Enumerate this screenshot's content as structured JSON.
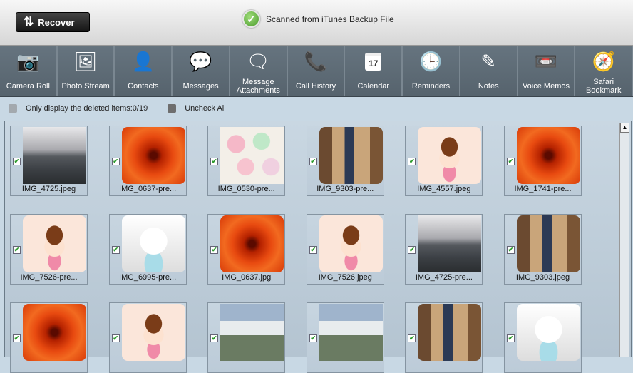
{
  "header": {
    "recover_label": "Recover",
    "status_text": "Scanned from iTunes Backup File"
  },
  "toolbar": [
    {
      "label": "Camera Roll",
      "icon": "camera-icon",
      "glyph": "📷"
    },
    {
      "label": "Photo Stream",
      "icon": "photo-stream-icon",
      "glyph": "🖼"
    },
    {
      "label": "Contacts",
      "icon": "contact-icon",
      "glyph": "👤"
    },
    {
      "label": "Messages",
      "icon": "message-bubble-icon",
      "glyph": "💬"
    },
    {
      "label": "Message Attachments",
      "icon": "message-attachment-icon",
      "glyph": "🗨"
    },
    {
      "label": "Call History",
      "icon": "phone-icon",
      "glyph": "📞"
    },
    {
      "label": "Calendar",
      "icon": "calendar-icon",
      "glyph": "17"
    },
    {
      "label": "Reminders",
      "icon": "clock-icon",
      "glyph": "🕒"
    },
    {
      "label": "Notes",
      "icon": "note-pen-icon",
      "glyph": "✎"
    },
    {
      "label": "Voice Memos",
      "icon": "cassette-icon",
      "glyph": "📼"
    },
    {
      "label": "Safari Bookmark",
      "icon": "compass-icon",
      "glyph": "🧭"
    }
  ],
  "filters": {
    "deleted_label": "Only display the deleted items:0/19",
    "uncheck_label": "Uncheck All"
  },
  "items": [
    {
      "name": "IMG_4725.jpeg",
      "thumb": "sea"
    },
    {
      "name": "IMG_0637-pre...",
      "thumb": "flower"
    },
    {
      "name": "IMG_0530-pre...",
      "thumb": "cupcake"
    },
    {
      "name": "IMG_9303-pre...",
      "thumb": "room"
    },
    {
      "name": "IMG_4557.jpeg",
      "thumb": "girl"
    },
    {
      "name": "IMG_1741-pre...",
      "thumb": "flower"
    },
    {
      "name": "IMG_7526-pre...",
      "thumb": "girl"
    },
    {
      "name": "IMG_6995-pre...",
      "thumb": "cat"
    },
    {
      "name": "IMG_0637.jpg",
      "thumb": "flower"
    },
    {
      "name": "IMG_7526.jpeg",
      "thumb": "girl"
    },
    {
      "name": "IMG_4725-pre...",
      "thumb": "sea"
    },
    {
      "name": "IMG_9303.jpeg",
      "thumb": "room"
    },
    {
      "thumb": "flower"
    },
    {
      "thumb": "girl"
    },
    {
      "thumb": "sign"
    },
    {
      "thumb": "sign"
    },
    {
      "thumb": "room"
    },
    {
      "thumb": "cat"
    }
  ]
}
